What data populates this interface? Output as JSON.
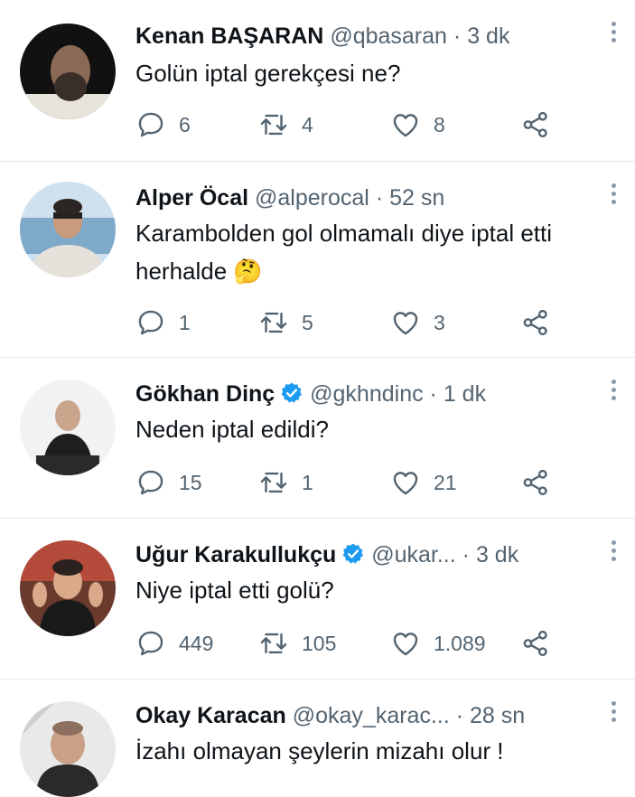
{
  "tweets": [
    {
      "name": "Kenan BAŞARAN",
      "handle": "@qbasaran",
      "time": "3 dk",
      "verified": false,
      "text_lines": [
        "Golün iptal gerekçesi ne?"
      ],
      "replies": "6",
      "retweets": "4",
      "likes": "8"
    },
    {
      "name": "Alper Öcal",
      "handle": "@alperocal",
      "time": "52 sn",
      "verified": false,
      "text_lines": [
        "Karambolden gol olmamalı diye iptal etti",
        "herhalde 🤔"
      ],
      "replies": "1",
      "retweets": "5",
      "likes": "3"
    },
    {
      "name": "Gökhan Dinç",
      "handle": "@gkhndinc",
      "time": "1 dk",
      "verified": true,
      "text_lines": [
        "Neden iptal edildi?"
      ],
      "replies": "15",
      "retweets": "1",
      "likes": "21"
    },
    {
      "name": "Uğur Karakullukçu",
      "handle": "@ukar...",
      "time": "3 dk",
      "verified": true,
      "text_lines": [
        "Niye iptal etti golü?"
      ],
      "replies": "449",
      "retweets": "105",
      "likes": "1.089"
    },
    {
      "name": "Okay Karacan",
      "handle": "@okay_karac...",
      "time": "28 sn",
      "verified": false,
      "text_lines": [
        "İzahı olmayan şeylerin mizahı olur !"
      ],
      "replies": "",
      "retweets": "",
      "likes": ""
    }
  ],
  "separator": "·",
  "colors": {
    "text": "#0f1419",
    "secondary": "#536471",
    "verified": "#1d9bf0",
    "divider": "#e6e8ea"
  }
}
